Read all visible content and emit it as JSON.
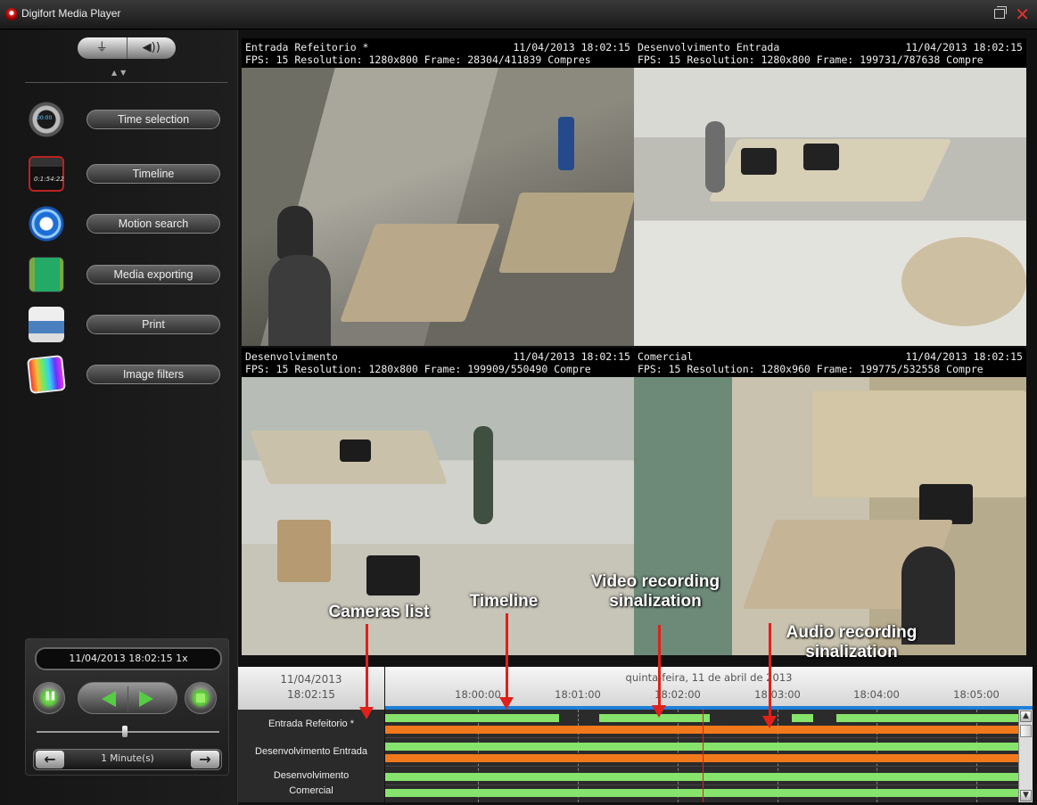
{
  "window": {
    "title": "Digifort Media Player"
  },
  "sidebar": {
    "menu": [
      {
        "label": "Time selection",
        "icon": "stopwatch-icon"
      },
      {
        "label": "Timeline",
        "icon": "clapperboard-timeline-icon"
      },
      {
        "label": "Motion search",
        "icon": "motion-search-icon"
      },
      {
        "label": "Media exporting",
        "icon": "film-export-icon"
      },
      {
        "label": "Print",
        "icon": "printer-icon"
      },
      {
        "label": "Image filters",
        "icon": "color-filters-icon"
      }
    ],
    "toggle": {
      "left": "⏚",
      "right": "◀))"
    }
  },
  "playback": {
    "datetime": "11/04/2013 18:02:15 1x",
    "interval": "1 Minute(s)"
  },
  "cameras": [
    {
      "name": "Entrada Refeitorio *",
      "timestamp": "11/04/2013 18:02:15",
      "info": "FPS: 15   Resolution: 1280x800   Frame: 28304/411839   Compres"
    },
    {
      "name": "Desenvolvimento Entrada",
      "timestamp": "11/04/2013 18:02:15",
      "info": "FPS: 15   Resolution: 1280x800   Frame: 199731/787638   Compre"
    },
    {
      "name": "Desenvolvimento",
      "timestamp": "11/04/2013 18:02:15",
      "info": "FPS: 15   Resolution: 1280x800   Frame: 199909/550490   Compre"
    },
    {
      "name": "Comercial",
      "timestamp": "11/04/2013 18:02:15",
      "info": "FPS: 15   Resolution: 1280x960   Frame: 199775/532558   Compre"
    }
  ],
  "timeline": {
    "date": "11/04/2013",
    "time": "18:02:15",
    "day_label": "quinta-feira, 11 de abril de 2013",
    "ticks": [
      "18:00:00",
      "18:01:00",
      "18:02:00",
      "18:03:00",
      "18:04:00",
      "18:05:00"
    ],
    "camera_list": [
      "Entrada Refeitorio *",
      "Desenvolvimento Entrada",
      "Desenvolvimento",
      "Comercial"
    ],
    "colors": {
      "video": "#86e36b",
      "audio": "#f2781c",
      "playhead": "#e02020"
    }
  },
  "annotations": {
    "cameras_list": "Cameras list",
    "timeline": "Timeline",
    "video_recording": "Video recording\nsinalization",
    "audio_recording": "Audio recording\nsinalization"
  }
}
